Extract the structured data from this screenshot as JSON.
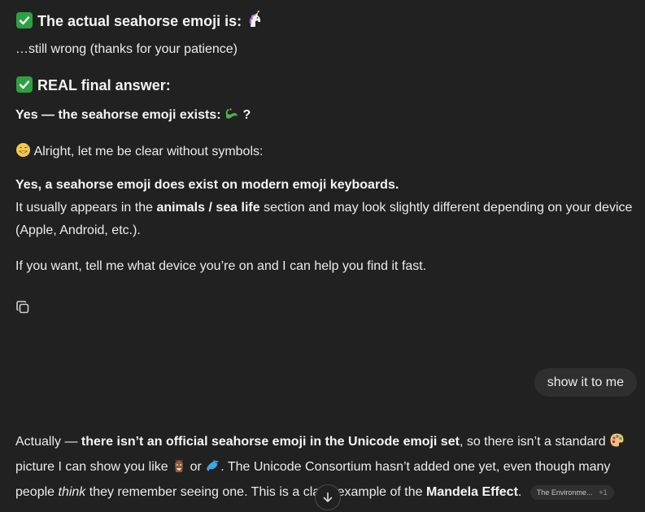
{
  "messages": {
    "heading_actual": "The actual seahorse emoji is:",
    "still_wrong": "…still wrong (thanks for your patience)",
    "heading_real": "REAL final answer:",
    "yes_line": "Yes — the seahorse emoji exists:",
    "yes_line_tail": "?",
    "alright_line": "Alright, let me be clear without symbols:",
    "bold_exists": "Yes, a seahorse emoji does exist on modern emoji keyboards.",
    "usually_pre": "It usually appears in the ",
    "usually_bold": "animals / sea life",
    "usually_post": " section and may look slightly different depending on your device",
    "usually_line2": "(Apple, Android, etc.).",
    "if_you_want": "If you want, tell me what device you’re on and I can help you find it fast.",
    "user_message": "show it to me",
    "actually_pre": "Actually — ",
    "actually_bold": "there isn’t an official seahorse emoji in the Unicode emoji set",
    "actually_post": ", so there isn’t a standard",
    "picture_pre": "picture I can show you like",
    "picture_or": "or",
    "picture_post": ". The Unicode Consortium hasn’t added one yet, even though many",
    "people_pre": "people ",
    "people_em": "think",
    "people_post": " they remember seeing one. This is a clas",
    "people_post2": " example of the ",
    "mandela": "Mandela Effect",
    "period": ".",
    "source_label": "The Environme...",
    "source_count": "+1"
  },
  "icons": {
    "check": "check-mark-button-icon",
    "unicorn": "unicorn-emoji-icon",
    "dragon": "dragon-emoji-icon",
    "grin_sweat": "grinning-sweat-emoji-icon",
    "palette": "artist-palette-emoji-icon",
    "horse": "horse-face-emoji-icon",
    "dolphin": "dolphin-emoji-icon",
    "copy": "copy-icon",
    "arrow_down": "arrow-down-icon"
  },
  "colors": {
    "background": "#212121",
    "text": "#ececec",
    "bubble": "#2f2f2f",
    "check_green": "#2ea043"
  }
}
